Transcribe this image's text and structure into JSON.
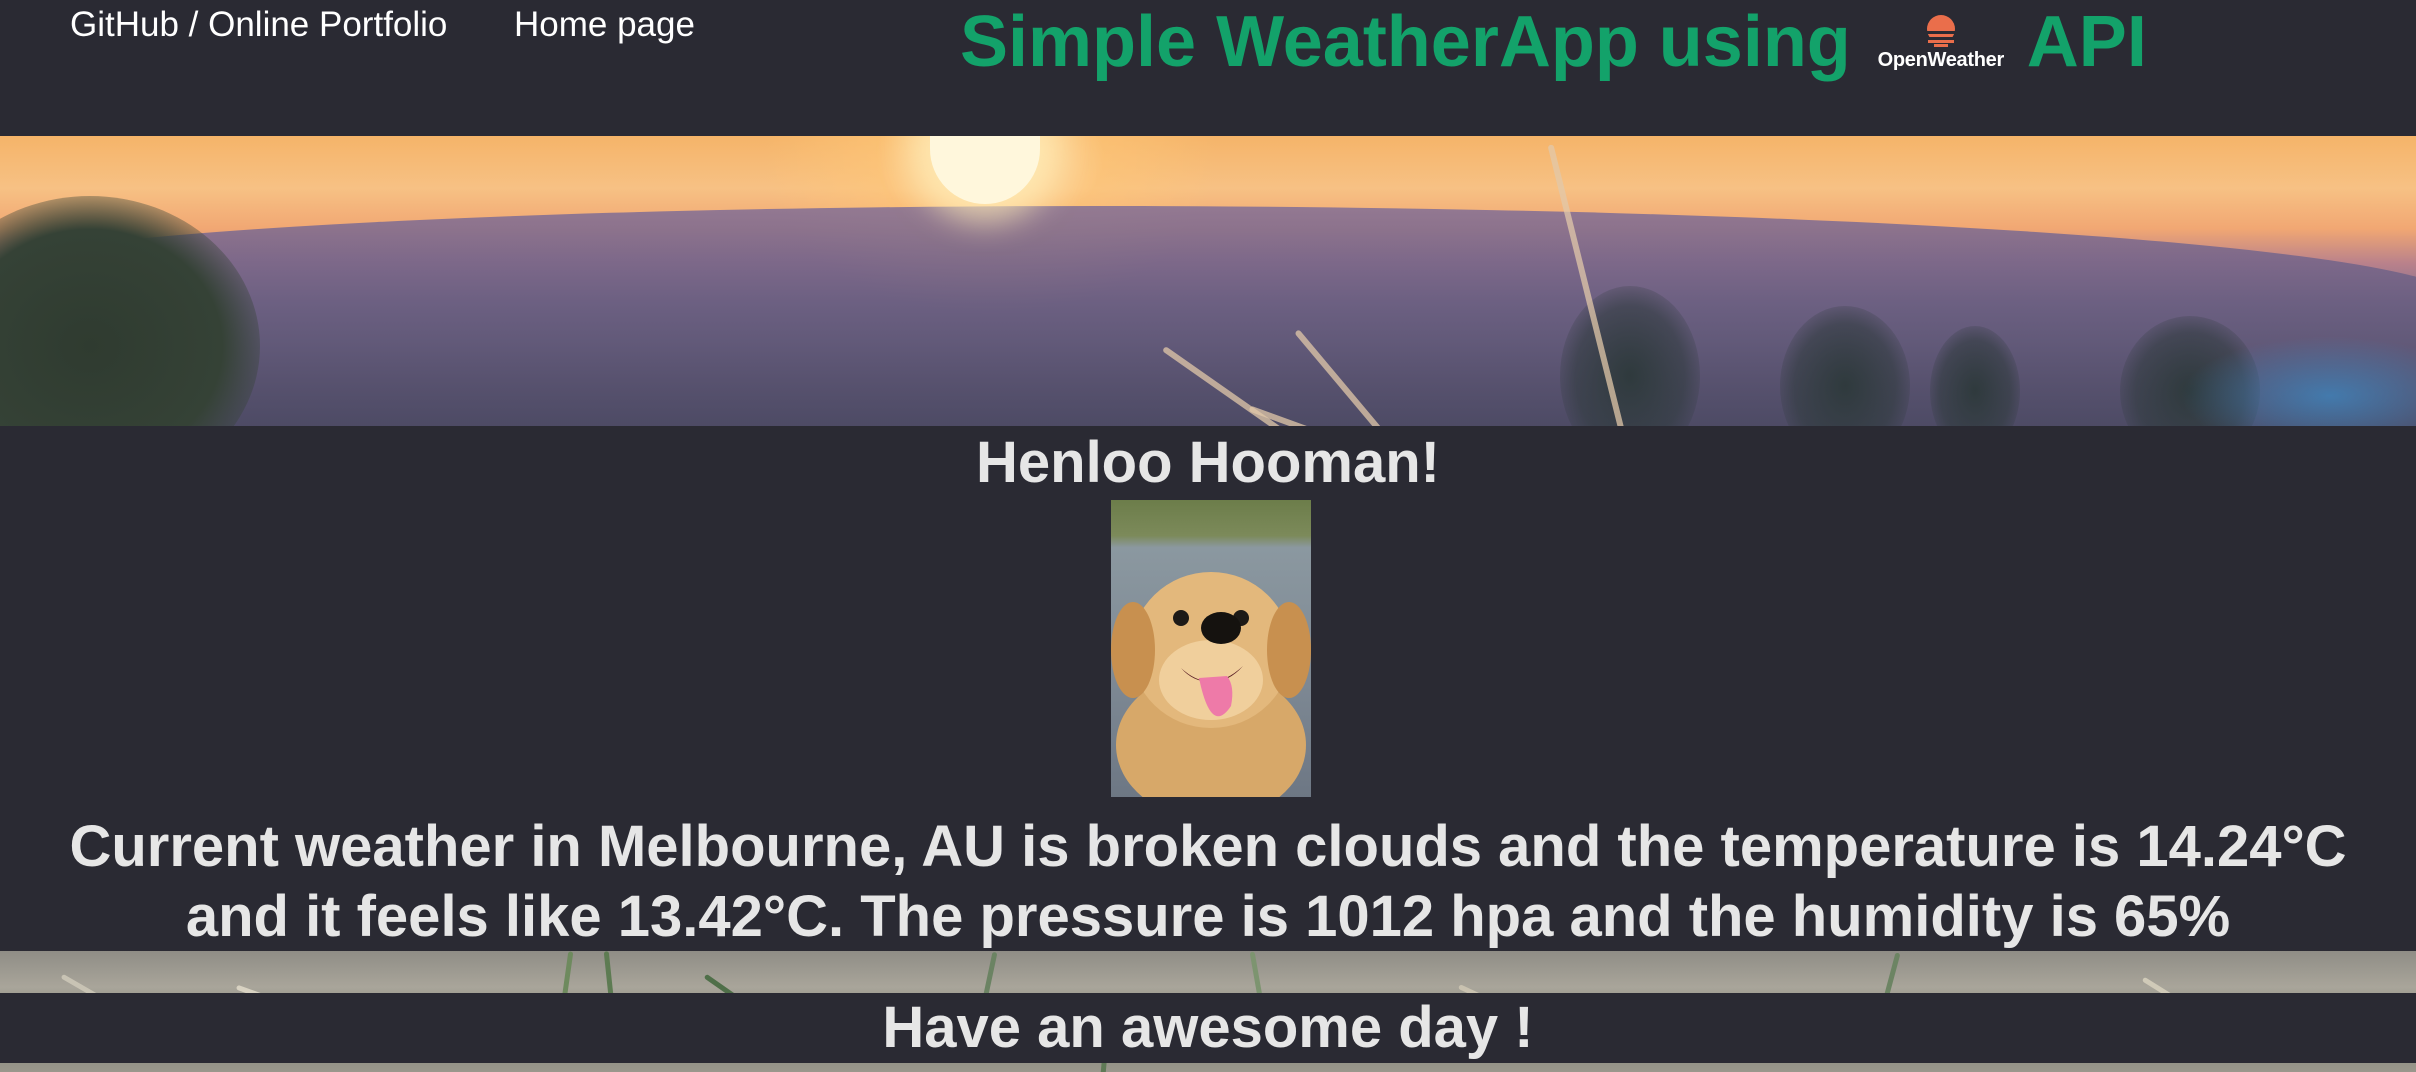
{
  "nav": {
    "github_label": "GitHub / Online Portfolio",
    "home_label": "Home page"
  },
  "header": {
    "title_before": "Simple WeatherApp using",
    "logo_text": "OpenWeather",
    "title_after": "API",
    "title_color": "#13a26a",
    "logo_color": "#ea6e4b"
  },
  "main": {
    "greeting": "Henloo Hooman!",
    "weather_line1": "Current weather in Melbourne, AU is broken clouds and the temperature is 14.24°C",
    "weather_line2": "and it feels like 13.42°C. The pressure is 1012 hpa and the humidity is 65%"
  },
  "footer": {
    "message": "Have an awesome day !"
  },
  "icons": {
    "logo": "openweather-logo-icon"
  },
  "colors": {
    "background": "#2a2a33",
    "text": "#e6e6e6",
    "nav_text": "#ffffff"
  }
}
